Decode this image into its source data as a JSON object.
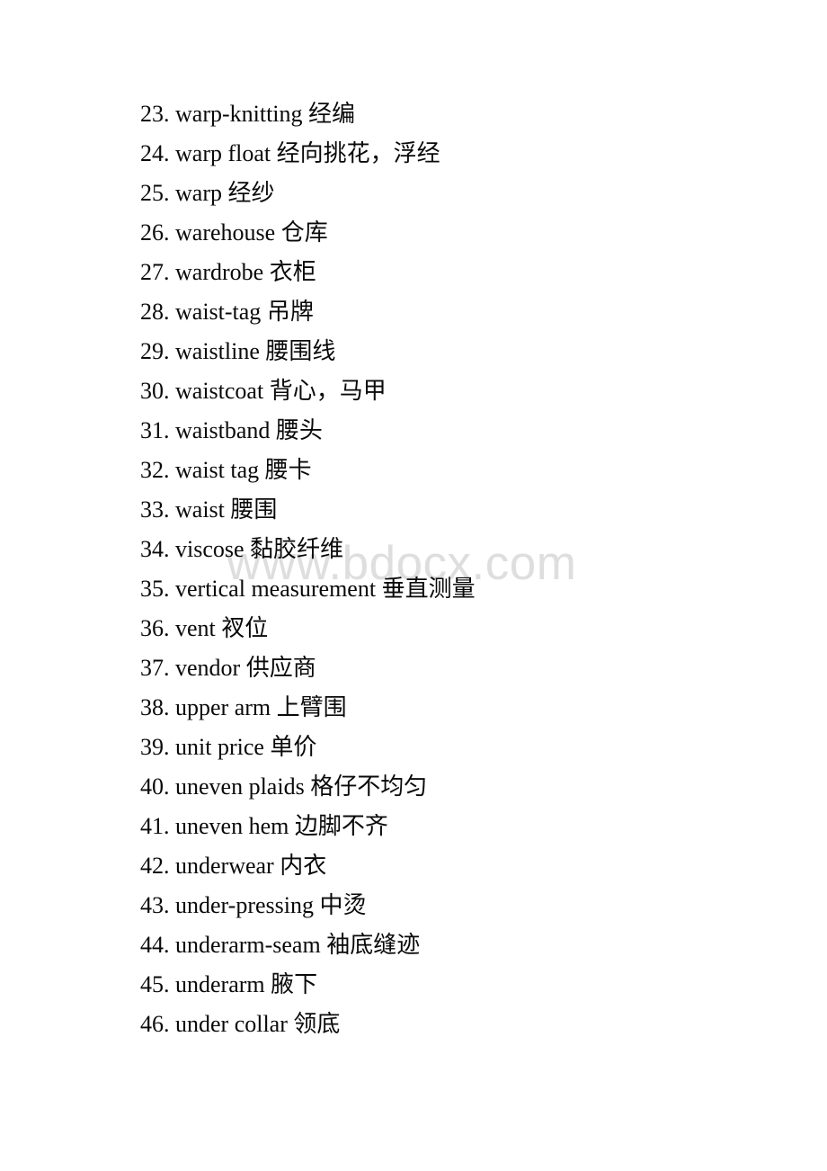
{
  "document": {
    "watermark": "www.bdocx.com",
    "watermark_color": "#dedede",
    "text_color": "#0a0a0a",
    "background_color": "#ffffff",
    "entries": [
      {
        "num": "23.",
        "term": "warp-knitting",
        "gloss": "经编"
      },
      {
        "num": "24.",
        "term": "warp float",
        "gloss": "经向挑花，浮经"
      },
      {
        "num": "25.",
        "term": "warp",
        "gloss": "经纱"
      },
      {
        "num": "26.",
        "term": "warehouse",
        "gloss": "仓库"
      },
      {
        "num": "27.",
        "term": "wardrobe",
        "gloss": "衣柜"
      },
      {
        "num": "28.",
        "term": "waist-tag",
        "gloss": "吊牌"
      },
      {
        "num": "29.",
        "term": "waistline",
        "gloss": "腰围线"
      },
      {
        "num": "30.",
        "term": "waistcoat",
        "gloss": "背心，马甲"
      },
      {
        "num": "31.",
        "term": "waistband",
        "gloss": "腰头"
      },
      {
        "num": "32.",
        "term": "waist tag",
        "gloss": "腰卡"
      },
      {
        "num": "33.",
        "term": "waist",
        "gloss": "腰围"
      },
      {
        "num": "34.",
        "term": "viscose",
        "gloss": "黏胶纤维"
      },
      {
        "num": "35.",
        "term": "vertical measurement",
        "gloss": "垂直测量"
      },
      {
        "num": "36.",
        "term": "vent",
        "gloss": "衩位"
      },
      {
        "num": "37.",
        "term": "vendor",
        "gloss": "供应商"
      },
      {
        "num": "38.",
        "term": "upper arm",
        "gloss": "上臂围"
      },
      {
        "num": "39.",
        "term": "unit price",
        "gloss": "单价"
      },
      {
        "num": "40.",
        "term": "uneven plaids",
        "gloss": "格仔不均匀"
      },
      {
        "num": "41.",
        "term": "uneven hem",
        "gloss": "边脚不齐"
      },
      {
        "num": "42.",
        "term": "underwear",
        "gloss": "内衣"
      },
      {
        "num": "43.",
        "term": "under-pressing",
        "gloss": "中烫"
      },
      {
        "num": "44.",
        "term": "underarm-seam",
        "gloss": "袖底缝迹"
      },
      {
        "num": "45.",
        "term": "underarm",
        "gloss": "腋下"
      },
      {
        "num": "46.",
        "term": "under collar",
        "gloss": "领底"
      }
    ]
  }
}
